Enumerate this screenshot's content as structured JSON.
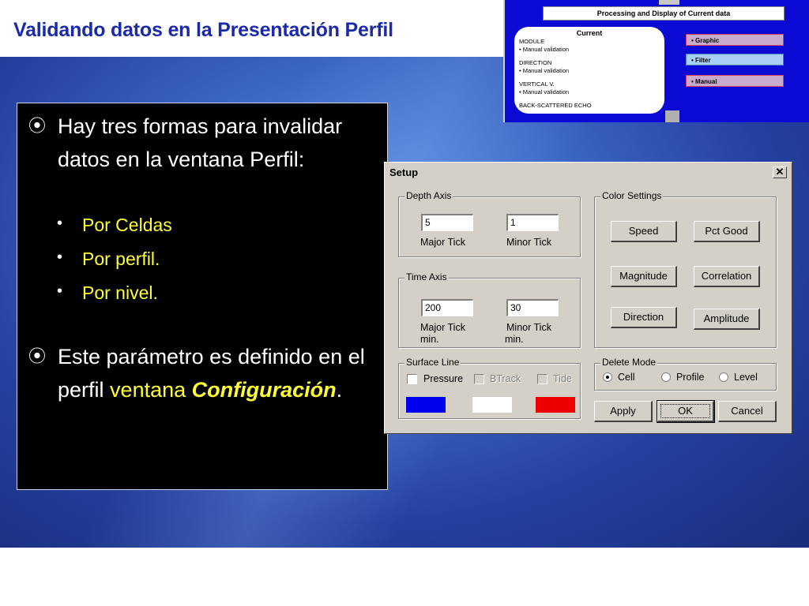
{
  "slide": {
    "title": "Validando datos en la Presentación Perfil",
    "bullets": [
      {
        "text": "Hay tres formas para invalidar datos en la ventana Perfil:",
        "sub": [
          "Por Celdas",
          "Por perfil.",
          "Por nivel."
        ]
      },
      {
        "text_before": "Este parámetro es definido en el perfil",
        "highlight_plain": "ventana",
        "highlight_bold_italic": "Configuración",
        "text_after": "."
      }
    ],
    "bullet_glyph": "⦿",
    "sub_bullet_glyph": "•"
  },
  "inset": {
    "header": "Processing and Display of Current data",
    "card_title": "Current",
    "card_lines": [
      "MODULE",
      "•   Manual validation",
      "DIRECTION",
      "•   Manual validation",
      "VERTICAL V.",
      "•   Manual validation",
      "BACK-SCATTERED ECHO"
    ],
    "buttons": [
      "•   Graphic",
      "•   Filter",
      "•   Manual"
    ]
  },
  "dialog": {
    "title": "Setup",
    "close_glyph": "✕",
    "depth_axis": {
      "label": "Depth Axis",
      "major_value": "5",
      "minor_value": "1",
      "major_label": "Major Tick",
      "minor_label": "Minor Tick"
    },
    "time_axis": {
      "label": "Time Axis",
      "major_value": "200",
      "minor_value": "30",
      "major_label": "Major Tick",
      "major_label2": "min.",
      "minor_label": "Minor Tick",
      "minor_label2": "min."
    },
    "surface_line": {
      "label": "Surface Line",
      "pressure": "Pressure",
      "btrack": "BTrack",
      "tide": "Tide",
      "colors": [
        "#0000ee",
        "#ffffff",
        "#ee0000"
      ]
    },
    "color_settings": {
      "label": "Color Settings",
      "buttons": [
        "Speed",
        "Pct Good",
        "Magnitude",
        "Correlation",
        "Direction",
        "Amplitude"
      ]
    },
    "delete_mode": {
      "label": "Delete Mode",
      "options": [
        "Cell",
        "Profile",
        "Level"
      ],
      "selected": "Cell"
    },
    "actions": {
      "apply": "Apply",
      "ok": "OK",
      "cancel": "Cancel"
    }
  }
}
